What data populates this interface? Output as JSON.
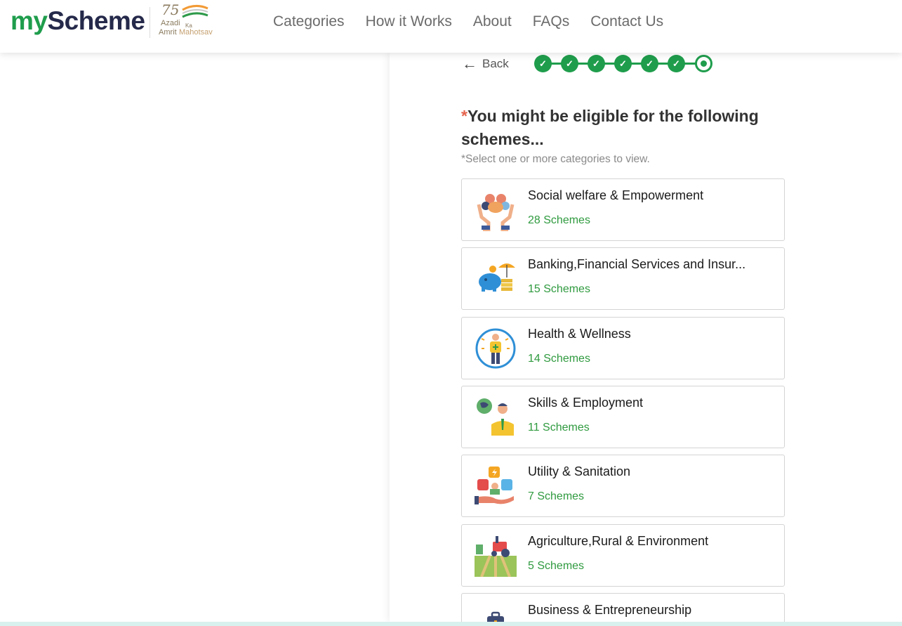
{
  "header": {
    "brand_my": "my",
    "brand_scheme": "Scheme",
    "akam": {
      "number": "75",
      "line1": "Azadi",
      "ka": "Ka",
      "line2": "Amrit",
      "mahotsav": "Mahotsav"
    },
    "nav": [
      "Categories",
      "How it Works",
      "About",
      "FAQs",
      "Contact Us"
    ]
  },
  "back_label": "Back",
  "stepper": {
    "total": 7,
    "completed": 6,
    "current": 7
  },
  "heading_star": "*",
  "heading": "You might be eligible for the following schemes...",
  "hint": "*Select one or more categories to view.",
  "categories": [
    {
      "title": "Social welfare & Empowerment",
      "count": "28 Schemes",
      "icon": "social-welfare-icon"
    },
    {
      "title": "Banking,Financial Services and Insur...",
      "count": "15 Schemes",
      "icon": "banking-icon"
    },
    {
      "title": "Health & Wellness",
      "count": "14 Schemes",
      "icon": "health-icon"
    },
    {
      "title": "Skills & Employment",
      "count": "11 Schemes",
      "icon": "skills-icon"
    },
    {
      "title": "Utility & Sanitation",
      "count": "7 Schemes",
      "icon": "utility-icon"
    },
    {
      "title": "Agriculture,Rural & Environment",
      "count": "5 Schemes",
      "icon": "agriculture-icon"
    },
    {
      "title": "Business & Entrepreneurship",
      "count": "",
      "icon": "business-icon"
    }
  ],
  "colors": {
    "brand_green": "#1f9d4c",
    "brand_navy": "#25294a",
    "count_green": "#2f9a3f",
    "accent_star": "#e4634c"
  }
}
